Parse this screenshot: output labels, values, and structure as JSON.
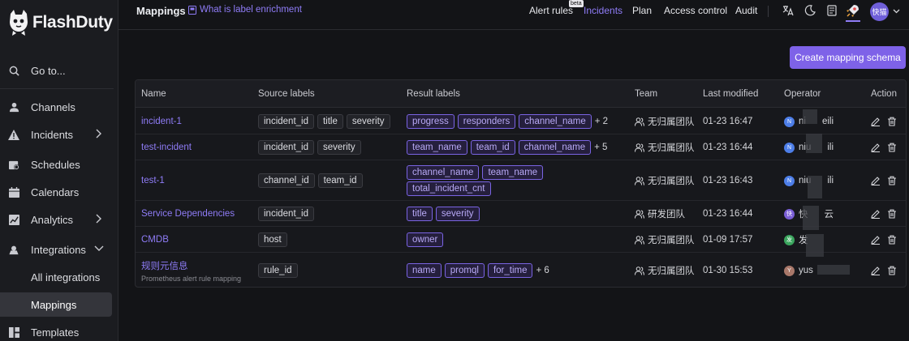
{
  "brand": {
    "name": "FlashDuty"
  },
  "sidebar": {
    "goto": "Go to...",
    "items": [
      {
        "label": "Channels",
        "icon": "user-icon"
      },
      {
        "label": "Incidents",
        "icon": "warning-icon",
        "chevron": "right"
      },
      {
        "label": "Schedules",
        "icon": "schedule-icon"
      },
      {
        "label": "Calendars",
        "icon": "calendar-icon"
      },
      {
        "label": "Analytics",
        "icon": "chart-icon",
        "chevron": "right"
      },
      {
        "label": "Integrations",
        "icon": "integration-icon",
        "chevron": "down"
      }
    ],
    "sub_items": [
      {
        "label": "All integrations"
      },
      {
        "label": "Mappings",
        "active": true
      }
    ],
    "templates": "Templates"
  },
  "header": {
    "title": "Mappings",
    "help": "What is label enrichment",
    "nav": [
      "Alert rules",
      "Incidents",
      "Plan",
      "Access control",
      "Audit"
    ],
    "active_nav": "Incidents",
    "beta": "beta",
    "avatar": "快猫"
  },
  "create_button": "Create mapping schema",
  "table": {
    "columns": [
      "Name",
      "Source labels",
      "Result labels",
      "Team",
      "Last modified",
      "Operator",
      "Action"
    ],
    "rows": [
      {
        "name": "incident-1",
        "desc": "",
        "source": [
          "incident_id",
          "title",
          "severity"
        ],
        "result": [
          "progress",
          "responders",
          "channel_name"
        ],
        "more": "+ 2",
        "team": "无归属团队",
        "modified": "01-23 16:47",
        "op_initial": "N",
        "op_name": "ni",
        "op_tail": "eili",
        "op_color": "#4d7ee8"
      },
      {
        "name": "test-incident",
        "desc": "",
        "source": [
          "incident_id",
          "severity"
        ],
        "result": [
          "team_name",
          "team_id",
          "channel_name"
        ],
        "more": "+ 5",
        "team": "无归属团队",
        "modified": "01-23 16:44",
        "op_initial": "N",
        "op_name": "niu",
        "op_tail": "ili",
        "op_color": "#4d7ee8"
      },
      {
        "name": "test-1",
        "desc": "",
        "source": [
          "channel_id",
          "team_id"
        ],
        "result": [
          "channel_name",
          "team_name",
          "total_incident_cnt"
        ],
        "more": "",
        "team": "无归属团队",
        "modified": "01-23 16:43",
        "op_initial": "N",
        "op_name": "niu",
        "op_tail": "ili",
        "op_color": "#4d7ee8"
      },
      {
        "name": "Service Dependencies",
        "desc": "",
        "source": [
          "incident_id"
        ],
        "result": [
          "title",
          "severity"
        ],
        "more": "",
        "team": "研发团队",
        "modified": "01-23 16:44",
        "op_initial": "快",
        "op_name": "快",
        "op_tail": "云",
        "op_color": "#7b5fd6"
      },
      {
        "name": "CMDB",
        "desc": "",
        "source": [
          "host"
        ],
        "result": [
          "owner"
        ],
        "more": "",
        "team": "无归属团队",
        "modified": "01-09 17:57",
        "op_initial": "发",
        "op_name": "发",
        "op_tail": "",
        "op_color": "#3aa55d"
      },
      {
        "name": "规则元信息",
        "desc": "Prometheus alert rule mapping",
        "source": [
          "rule_id"
        ],
        "result": [
          "name",
          "promql",
          "for_time"
        ],
        "more": "+ 6",
        "team": "无归属团队",
        "modified": "01-30 15:53",
        "op_initial": "Y",
        "op_name": "yus",
        "op_tail": "",
        "op_color": "#a9786a"
      }
    ]
  }
}
